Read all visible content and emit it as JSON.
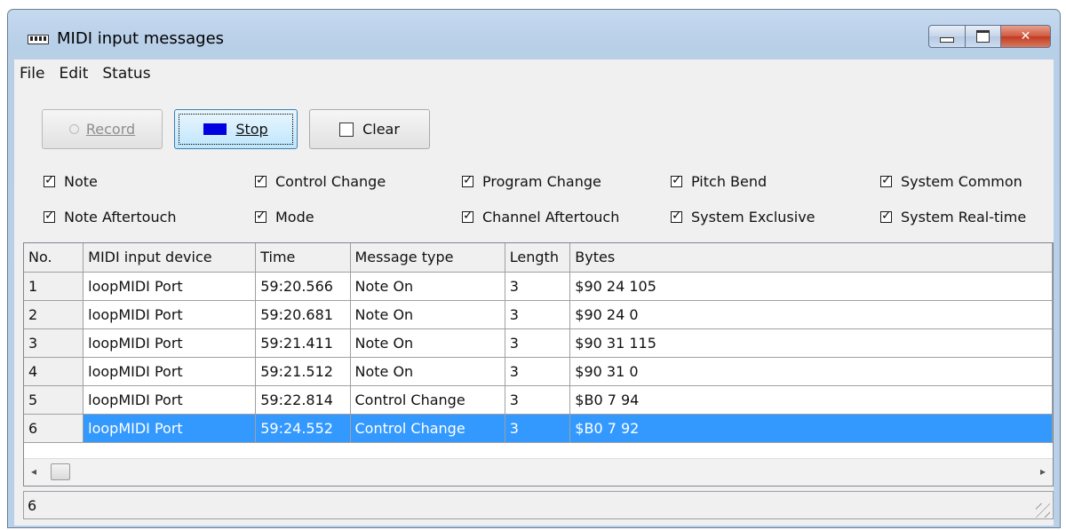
{
  "window": {
    "title": "MIDI input messages",
    "minimize_icon": "minimize-icon",
    "maximize_icon": "maximize-icon",
    "close_icon": "close-icon",
    "close_glyph": "✕"
  },
  "menu": [
    "File",
    "Edit",
    "Status"
  ],
  "toolbar": {
    "record_label": "Record",
    "stop_label": "Stop",
    "clear_label": "Clear"
  },
  "filters": {
    "note": "Note",
    "control_change": "Control Change",
    "program_change": "Program Change",
    "pitch_bend": "Pitch Bend",
    "system_common": "System Common",
    "note_aftertouch": "Note Aftertouch",
    "mode": "Mode",
    "channel_aftertouch": "Channel Aftertouch",
    "system_exclusive": "System Exclusive",
    "system_realtime": "System Real-time"
  },
  "table": {
    "columns": [
      "No.",
      "MIDI input device",
      "Time",
      "Message type",
      "Length",
      "Bytes"
    ],
    "rows": [
      [
        "1",
        "loopMIDI Port",
        "59:20.566",
        "Note On",
        "3",
        "$90 24 105"
      ],
      [
        "2",
        "loopMIDI Port",
        "59:20.681",
        "Note On",
        "3",
        "$90 24 0"
      ],
      [
        "3",
        "loopMIDI Port",
        "59:21.411",
        "Note On",
        "3",
        "$90 31 115"
      ],
      [
        "4",
        "loopMIDI Port",
        "59:21.512",
        "Note On",
        "3",
        "$90 31 0"
      ],
      [
        "5",
        "loopMIDI Port",
        "59:22.814",
        "Control Change",
        "3",
        "$B0 7 94"
      ],
      [
        "6",
        "loopMIDI Port",
        "59:24.552",
        "Control Change",
        "3",
        "$B0 7 92"
      ]
    ],
    "selected_row": 6
  },
  "scroll": {
    "left_arrow": "◂",
    "right_arrow": "▸"
  },
  "status": {
    "count": "6"
  },
  "colors": {
    "selection": "#3399ff",
    "stop_square": "#0000e0"
  }
}
